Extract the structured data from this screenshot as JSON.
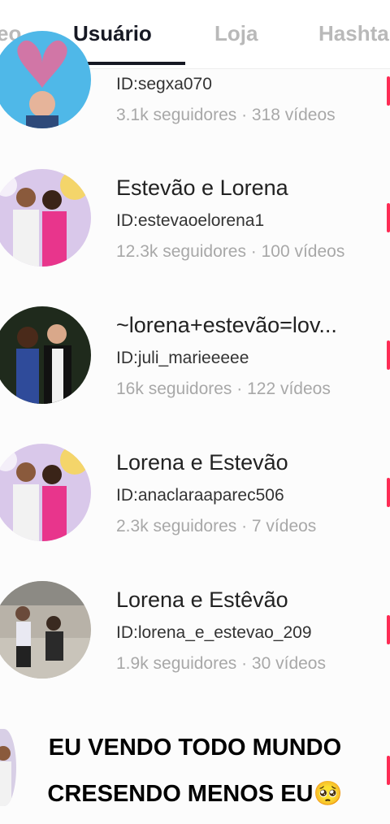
{
  "tabs": {
    "left_partial": "eo",
    "active": "Usuário",
    "shop": "Loja",
    "hashtag": "Hashta"
  },
  "results": [
    {
      "name": "",
      "id": "ID:segxa070",
      "stats": "3.1k seguidores · 318  vídeos"
    },
    {
      "name": "Estevão e Lorena",
      "id": "ID:estevaoelorena1",
      "stats": "12.3k seguidores · 100  vídeos"
    },
    {
      "name": "~lorena+estevão=lov...",
      "id": "ID:juli_marieeeee",
      "stats": "16k seguidores · 122  vídeos"
    },
    {
      "name": "Lorena e  Estevão",
      "id": "ID:anaclaraaparec506",
      "stats": "2.3k seguidores · 7  vídeos"
    },
    {
      "name": "Lorena e Estêvão",
      "id": "ID:lorena_e_estevao_209",
      "stats": "1.9k seguidores · 30  vídeos"
    }
  ],
  "overlay": {
    "line1": "EU VENDO TODO MUNDO",
    "line2": "CRESENDO MENOS EU",
    "emoji": "🥺"
  },
  "colors": {
    "accent": "#fe2c55",
    "active_tab": "#161823",
    "muted": "#a8a8a8"
  }
}
